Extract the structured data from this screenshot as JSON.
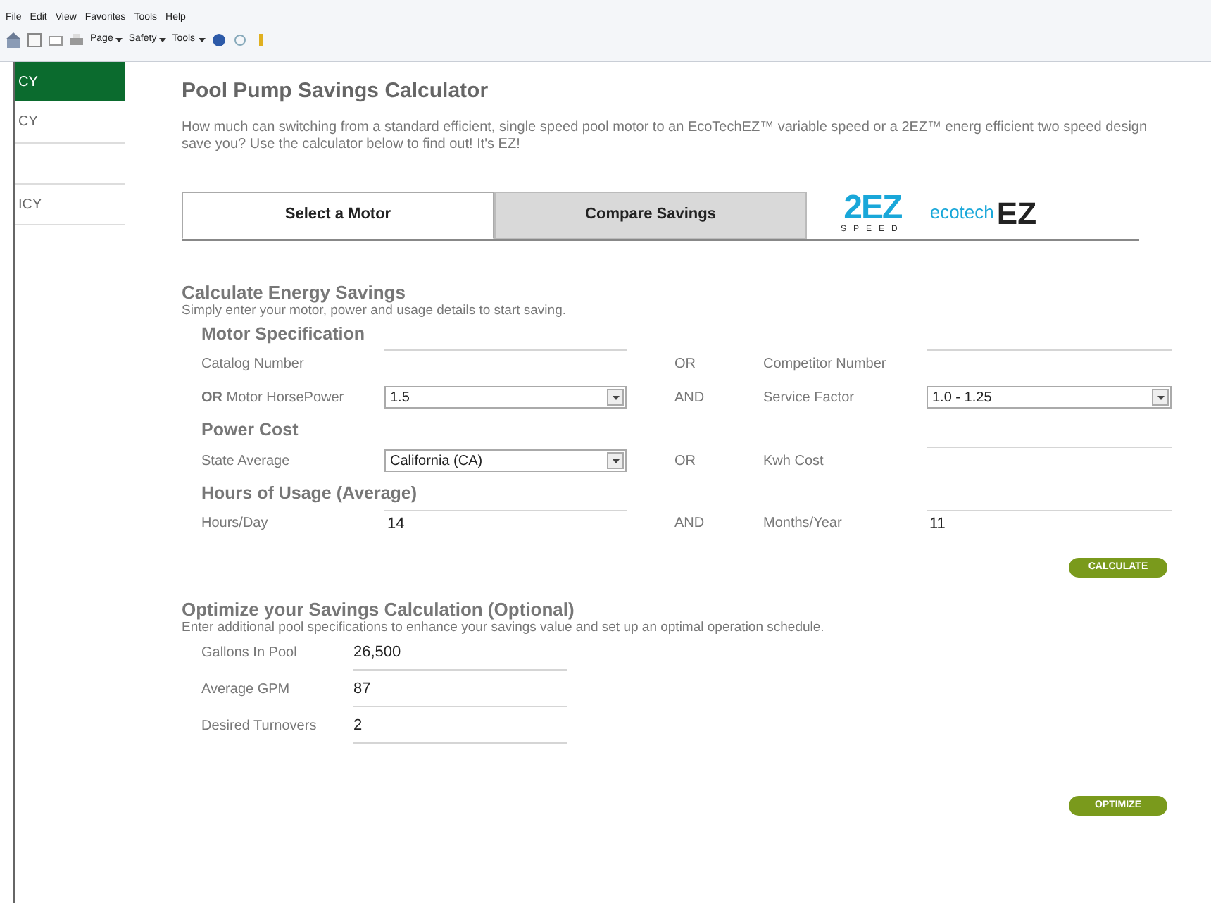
{
  "menu_bar": [
    "File",
    "Edit",
    "View",
    "Favorites",
    "Tools",
    "Help"
  ],
  "command_bar": [
    {
      "kind": "home"
    },
    {
      "kind": "feeds"
    },
    {
      "kind": "mail"
    },
    {
      "kind": "print"
    },
    {
      "kind": "menu",
      "label": "Page"
    },
    {
      "kind": "menu",
      "label": "Safety"
    },
    {
      "kind": "menu",
      "label": "Tools"
    },
    {
      "kind": "help"
    },
    {
      "kind": "research"
    },
    {
      "kind": "addon"
    }
  ],
  "sidebar": {
    "items": [
      {
        "label": "CY",
        "selected": true
      },
      {
        "label": "CY",
        "selected": false
      },
      {
        "label": "ICY",
        "selected": false
      }
    ]
  },
  "title": "Pool Pump Savings Calculator",
  "intro": "How much can switching from a standard efficient, single speed pool motor to an EcoTechEZ™ variable speed or a 2EZ™ energ efficient two speed design save you? Use the calculator below to find out! It's EZ!",
  "tabs": [
    {
      "label": "Select a Motor",
      "selected": true
    },
    {
      "label": "Compare Savings",
      "selected": false
    }
  ],
  "logos": {
    "two_speed": {
      "mark": "2EZ",
      "sub": "SPEED"
    },
    "ecotech": {
      "prefix": "ecotech",
      "mark": "EZ"
    }
  },
  "calculate": {
    "heading": "Calculate Energy Savings",
    "subtitle": "Simply enter your motor, power and usage details to start saving.",
    "sections": [
      {
        "heading": "Motor Specification",
        "rows": [
          {
            "left": {
              "label": "Catalog Number",
              "field": {
                "kind": "text"
              }
            },
            "conjunction": "OR",
            "right": {
              "label": "Competitor Number",
              "field": {
                "kind": "text"
              }
            }
          },
          {
            "left": {
              "label": "**OR** Motor HorsePower",
              "field": {
                "kind": "select",
                "value": "1.5"
              }
            },
            "conjunction": "AND",
            "right": {
              "label": "Service Factor",
              "field": {
                "kind": "select",
                "value": "1.0 - 1.25"
              }
            }
          }
        ]
      },
      {
        "heading": "Power Cost",
        "rows": [
          {
            "left": {
              "label": "State Average",
              "field": {
                "kind": "select",
                "value": "California (CA)"
              }
            },
            "conjunction": "OR",
            "right": {
              "label": "Kwh Cost",
              "field": {
                "kind": "text"
              }
            }
          }
        ]
      },
      {
        "heading": "Hours of Usage (Average)",
        "rows": [
          {
            "left": {
              "label": "Hours/Day",
              "field": {
                "kind": "text",
                "value": "14"
              }
            },
            "conjunction": "AND",
            "right": {
              "label": "Months/Year",
              "field": {
                "kind": "text",
                "value": "11"
              }
            }
          }
        ]
      }
    ],
    "button": "CALCULATE"
  },
  "optimize": {
    "heading": "Optimize your Savings Calculation (Optional)",
    "subtitle": "Enter additional pool specifications to enhance your savings value and set up an optimal operation schedule.",
    "fields": [
      {
        "label": "Gallons In Pool",
        "value": "26,500"
      },
      {
        "label": "Average GPM",
        "value": "87"
      },
      {
        "label": "Desired Turnovers",
        "value": "2"
      }
    ],
    "button": "OPTIMIZE"
  }
}
